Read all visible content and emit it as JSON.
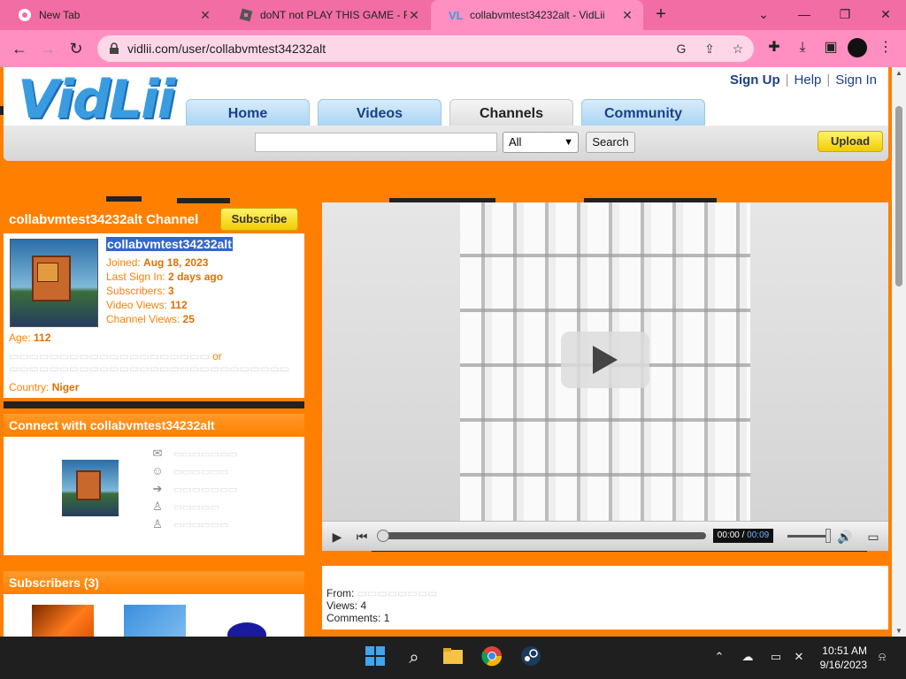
{
  "browser": {
    "tabs": [
      {
        "title": "New Tab",
        "active": false
      },
      {
        "title": "doNT not PLAY THIS GAME - Rol",
        "active": false
      },
      {
        "title": "collabvmtest34232alt - VidLii",
        "active": true
      }
    ],
    "new_tab_symbol": "+",
    "url": "vidlii.com/user/collabvmtest34232alt",
    "accent_color": "#ff8fc0"
  },
  "site": {
    "logo": "VidLii",
    "nav": [
      "Home",
      "Videos",
      "Channels",
      "Community"
    ],
    "active_nav": "Channels",
    "top_links": {
      "signup": "Sign Up",
      "help": "Help",
      "signin": "Sign In",
      "separator": "|"
    },
    "search": {
      "value": "",
      "category": "All",
      "button": "Search"
    },
    "upload": "Upload",
    "theme_color": "#ff8000"
  },
  "channel": {
    "title": "collabvmtest34232alt Channel",
    "subscribe": "Subscribe",
    "username": "collabvmtest34232alt",
    "joined_label": "Joined:",
    "joined": "Aug 18, 2023",
    "last_signin_label": "Last Sign In:",
    "last_signin": "2 days ago",
    "subscribers_label": "Subscribers:",
    "subscribers": "3",
    "video_views_label": "Video Views:",
    "video_views": "112",
    "channel_views_label": "Channel Views:",
    "channel_views": "25",
    "age_label": "Age:",
    "age": "112",
    "or_text": "or",
    "country_label": "Country:",
    "country": "Niger"
  },
  "connect": {
    "title": "Connect with collabvmtest34232alt"
  },
  "subscribers_section": {
    "title": "Subscribers (3)"
  },
  "player": {
    "current_time": "00:00",
    "separator": "/",
    "duration": "00:09",
    "progress": 0
  },
  "video_info": {
    "from_label": "From:",
    "views_label": "Views:",
    "views": "4",
    "comments_label": "Comments:",
    "comments": "1"
  },
  "taskbar": {
    "time": "10:51 AM",
    "date": "9/16/2023"
  }
}
